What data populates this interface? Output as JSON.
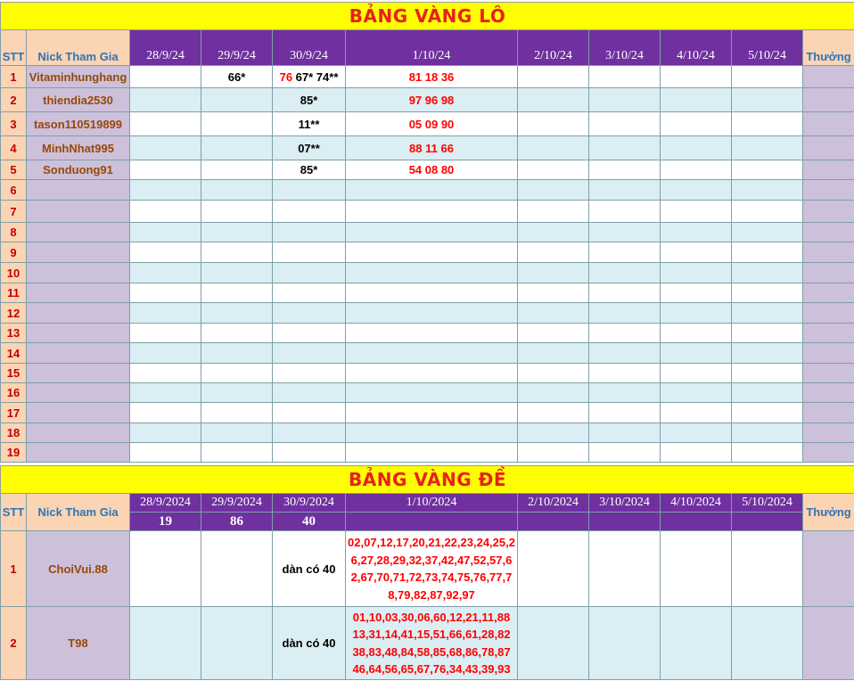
{
  "lo": {
    "title": "BẢNG VÀNG LÔ",
    "headers": {
      "stt": "STT",
      "nick": "Nick Tham Gia",
      "dates": [
        "28/9/24",
        "29/9/24",
        "30/9/24",
        "1/10/24",
        "2/10/24",
        "3/10/24",
        "4/10/24",
        "5/10/24"
      ],
      "reward": "Thưởng"
    },
    "rows": [
      {
        "stt": "1",
        "nick": "Vitaminhunghang",
        "d29": "66*",
        "d30_red": "76",
        "d30_black": " 67* 74**",
        "d1": "81 18 36"
      },
      {
        "stt": "2",
        "nick": "thiendia2530",
        "d29": "",
        "d30_red": "",
        "d30_black": "85*",
        "d1": "97 96 98"
      },
      {
        "stt": "3",
        "nick": "tason110519899",
        "d29": "",
        "d30_red": "",
        "d30_black": "11**",
        "d1": "05 09 90"
      },
      {
        "stt": "4",
        "nick": "MinhNhat995",
        "d29": "",
        "d30_red": "",
        "d30_black": "07**",
        "d1": "88 11 66"
      },
      {
        "stt": "5",
        "nick": "Sonduong91",
        "d29": "",
        "d30_red": "",
        "d30_black": "85*",
        "d1": "54 08 80"
      },
      {
        "stt": "6"
      },
      {
        "stt": "7"
      },
      {
        "stt": "8"
      },
      {
        "stt": "9"
      },
      {
        "stt": "10"
      },
      {
        "stt": "11"
      },
      {
        "stt": "12"
      },
      {
        "stt": "13"
      },
      {
        "stt": "14"
      },
      {
        "stt": "15"
      },
      {
        "stt": "16"
      },
      {
        "stt": "17"
      },
      {
        "stt": "18"
      },
      {
        "stt": "19"
      }
    ]
  },
  "de": {
    "title": "BẢNG VÀNG ĐỀ",
    "headers": {
      "stt": "STT",
      "nick": "Nick Tham Gia",
      "dates": [
        "28/9/2024",
        "29/9/2024",
        "30/9/2024",
        "1/10/2024",
        "2/10/2024",
        "3/10/2024",
        "4/10/2024",
        "5/10/2024"
      ],
      "results": [
        "19",
        "86",
        "40",
        "",
        "",
        "",
        "",
        ""
      ],
      "reward": "Thưởng"
    },
    "rows": [
      {
        "stt": "1",
        "nick": "ChoiVui.88",
        "d30": "dàn có 40",
        "d1": "02,07,12,17,20,21,22,23,24,25,26,27,28,29,32,37,42,47,52,57,62,67,70,71,72,73,74,75,76,77,78,79,82,87,92,97"
      },
      {
        "stt": "2",
        "nick": "T98",
        "d30": "dàn có 40",
        "d1": "01,10,03,30,06,60,12,21,11,88 13,31,14,41,15,51,66,61,28,82 38,83,48,84,58,85,68,86,78,87 46,64,56,65,67,76,34,43,39,93"
      }
    ]
  }
}
